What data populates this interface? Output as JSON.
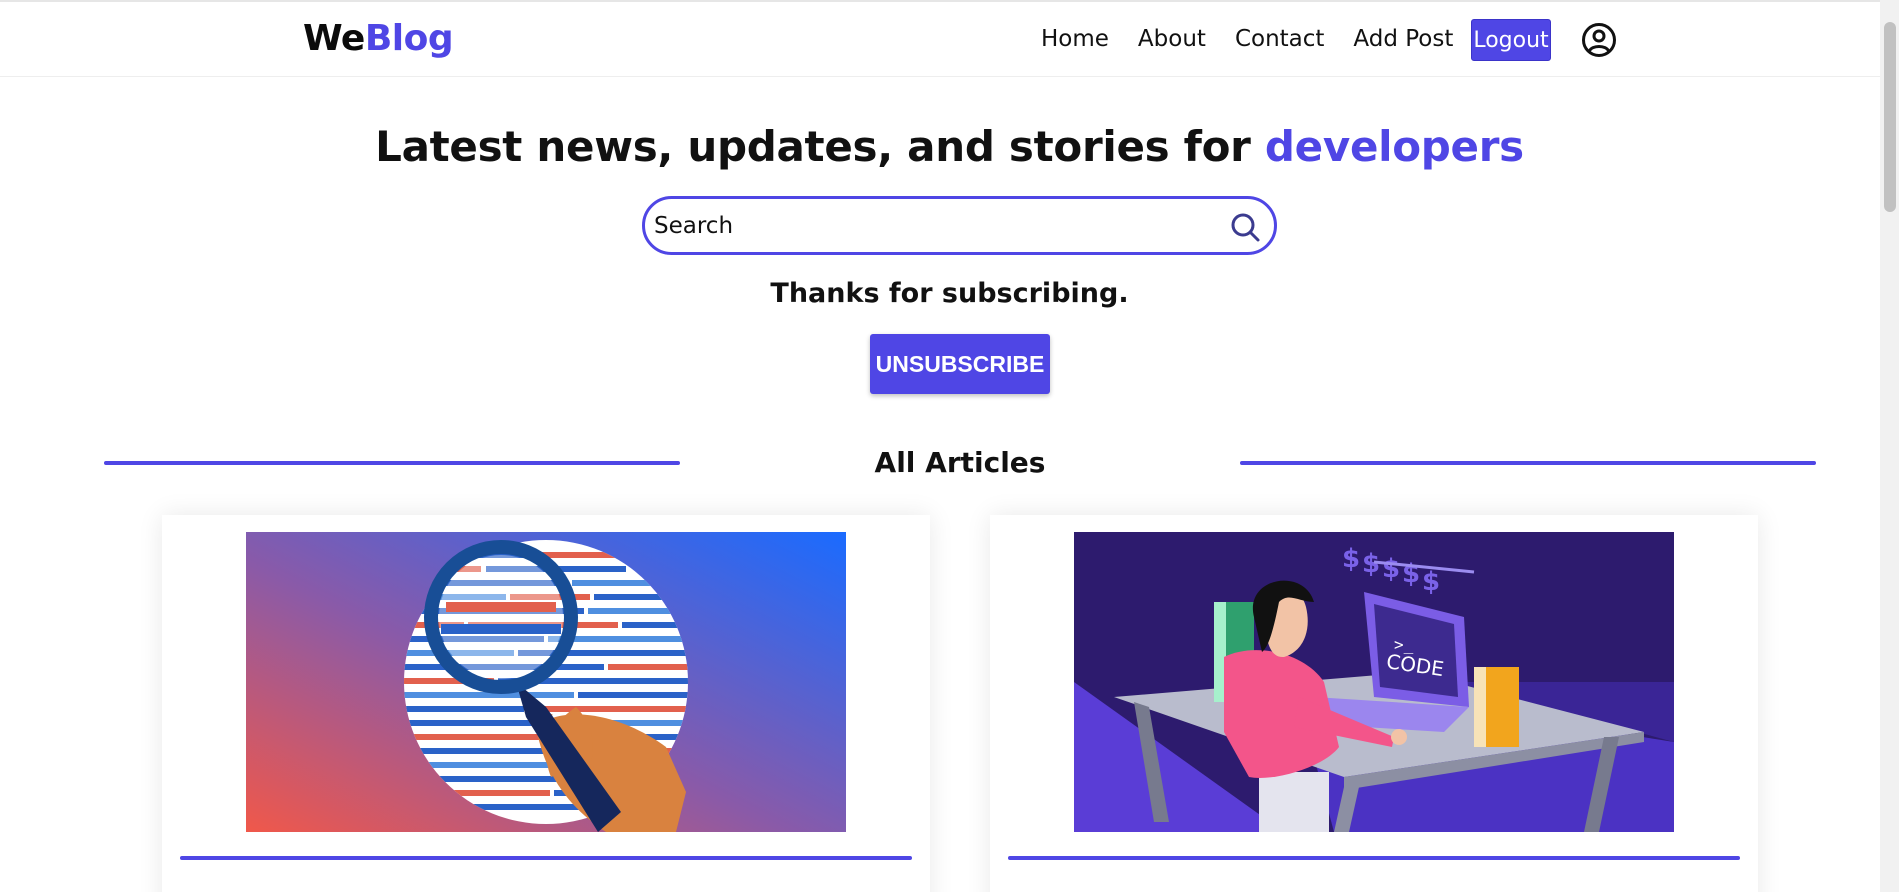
{
  "nav": {
    "brand_first": "We",
    "brand_second": "Blog",
    "links": [
      "Home",
      "About",
      "Contact",
      "Add Post"
    ],
    "logout_label": "Logout",
    "user_icon": "user-circle-icon"
  },
  "hero": {
    "title_prefix": "Latest news, updates, and stories for ",
    "title_accent": "developers"
  },
  "search": {
    "placeholder": "Search",
    "icon": "search-icon"
  },
  "subscription": {
    "message": "Thanks for subscribing.",
    "button_label": "UNSUBSCRIBE"
  },
  "section": {
    "title": "All Articles"
  },
  "articles": [
    {
      "image": "code-magnifier-illustration"
    },
    {
      "image": "developer-laptop-code-illustration"
    }
  ],
  "colors": {
    "accent": "#4f46e5",
    "text": "#111111",
    "background": "#ffffff"
  }
}
